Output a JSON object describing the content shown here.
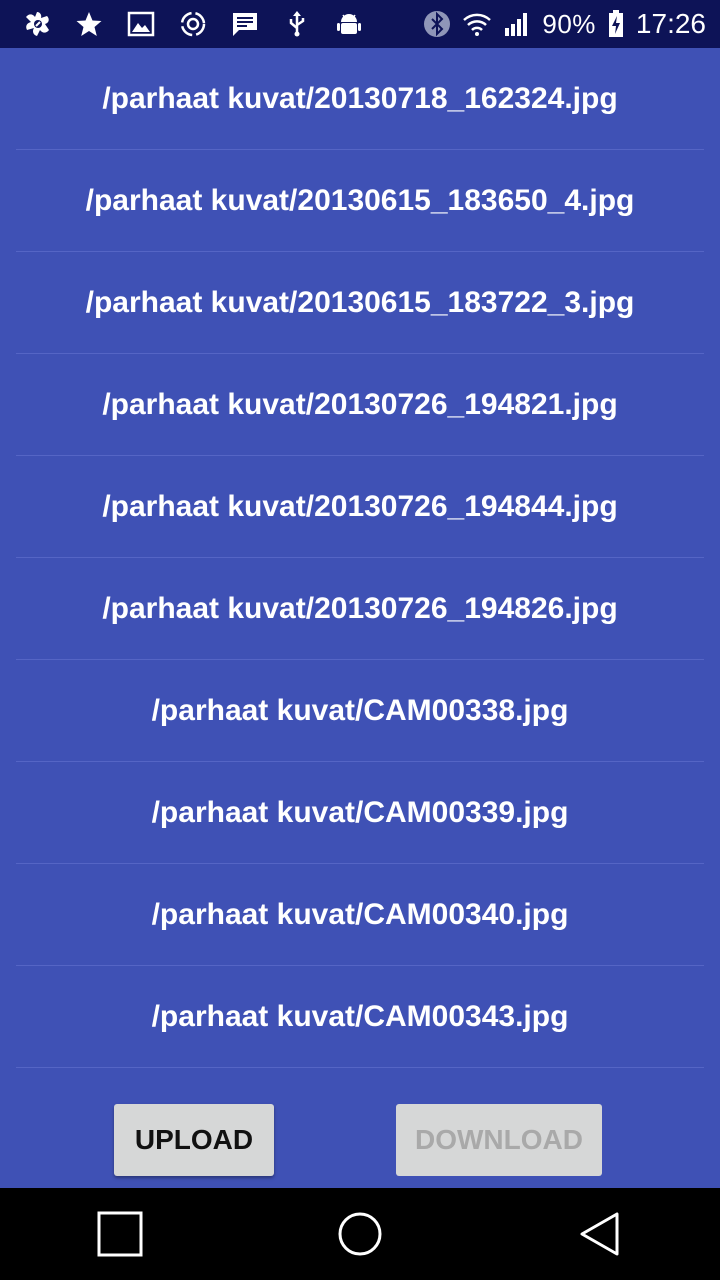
{
  "status_bar": {
    "battery_text": "90%",
    "time": "17:26",
    "left_icons": [
      "avast-icon",
      "star-icon",
      "gallery-icon",
      "sync-spiral-icon",
      "message-icon",
      "usb-icon",
      "android-debug-icon"
    ],
    "right_icons": [
      "bluetooth-icon",
      "wifi-icon",
      "signal-icon",
      "battery-charging-icon"
    ]
  },
  "files": [
    "/parhaat kuvat/20130718_162324.jpg",
    "/parhaat kuvat/20130615_183650_4.jpg",
    "/parhaat kuvat/20130615_183722_3.jpg",
    "/parhaat kuvat/20130726_194821.jpg",
    "/parhaat kuvat/20130726_194844.jpg",
    "/parhaat kuvat/20130726_194826.jpg",
    "/parhaat kuvat/CAM00338.jpg",
    "/parhaat kuvat/CAM00339.jpg",
    "/parhaat kuvat/CAM00340.jpg",
    "/parhaat kuvat/CAM00343.jpg"
  ],
  "buttons": {
    "upload_label": "UPLOAD",
    "download_label": "DOWNLOAD",
    "download_enabled": false
  },
  "nav_bar": {
    "icons": [
      "recents-square-icon",
      "home-circle-icon",
      "back-triangle-icon"
    ]
  },
  "colors": {
    "background": "#3f51b5",
    "status_bar": "#0d1357",
    "button_bg": "#d6d7d7"
  }
}
